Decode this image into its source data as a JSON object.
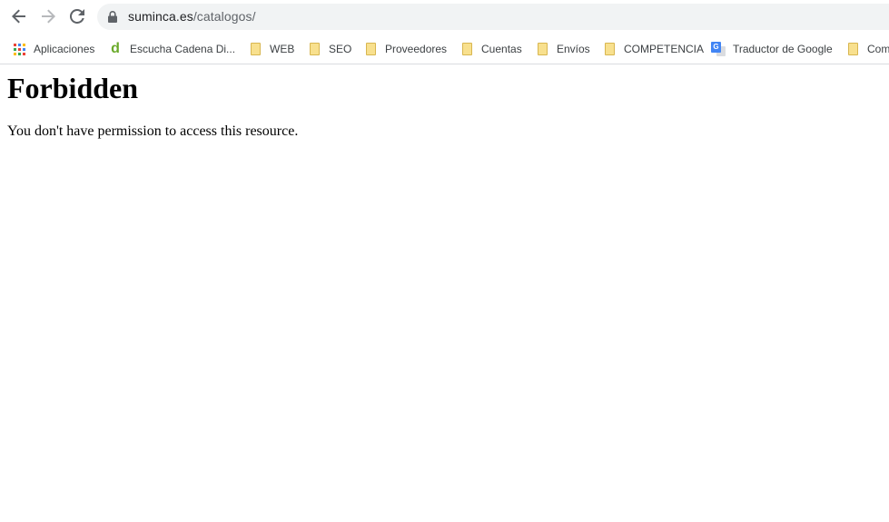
{
  "browser": {
    "url_host": "suminca.es",
    "url_path": "/catalogos/",
    "bookmarks": [
      {
        "label": "Aplicaciones",
        "icon": "apps-grid-icon"
      },
      {
        "label": "Escucha Cadena Di...",
        "icon": "cadena-dial-icon"
      },
      {
        "label": "WEB",
        "icon": "folder-icon"
      },
      {
        "label": "SEO",
        "icon": "folder-icon"
      },
      {
        "label": "Proveedores",
        "icon": "folder-icon"
      },
      {
        "label": "Cuentas",
        "icon": "folder-icon"
      },
      {
        "label": "Envíos",
        "icon": "folder-icon"
      },
      {
        "label": "COMPETENCIA",
        "icon": "folder-icon"
      },
      {
        "label": "Traductor de Google",
        "icon": "google-translate-icon"
      },
      {
        "label": "Com",
        "icon": "folder-icon"
      }
    ],
    "colors": {
      "omnibox_bg": "#f1f3f4",
      "folder_fill": "#f8e08e",
      "cadena_dial_green": "#6aaa2a",
      "google_blue": "#4285f4"
    }
  },
  "page": {
    "heading": "Forbidden",
    "message": "You don't have permission to access this resource."
  }
}
